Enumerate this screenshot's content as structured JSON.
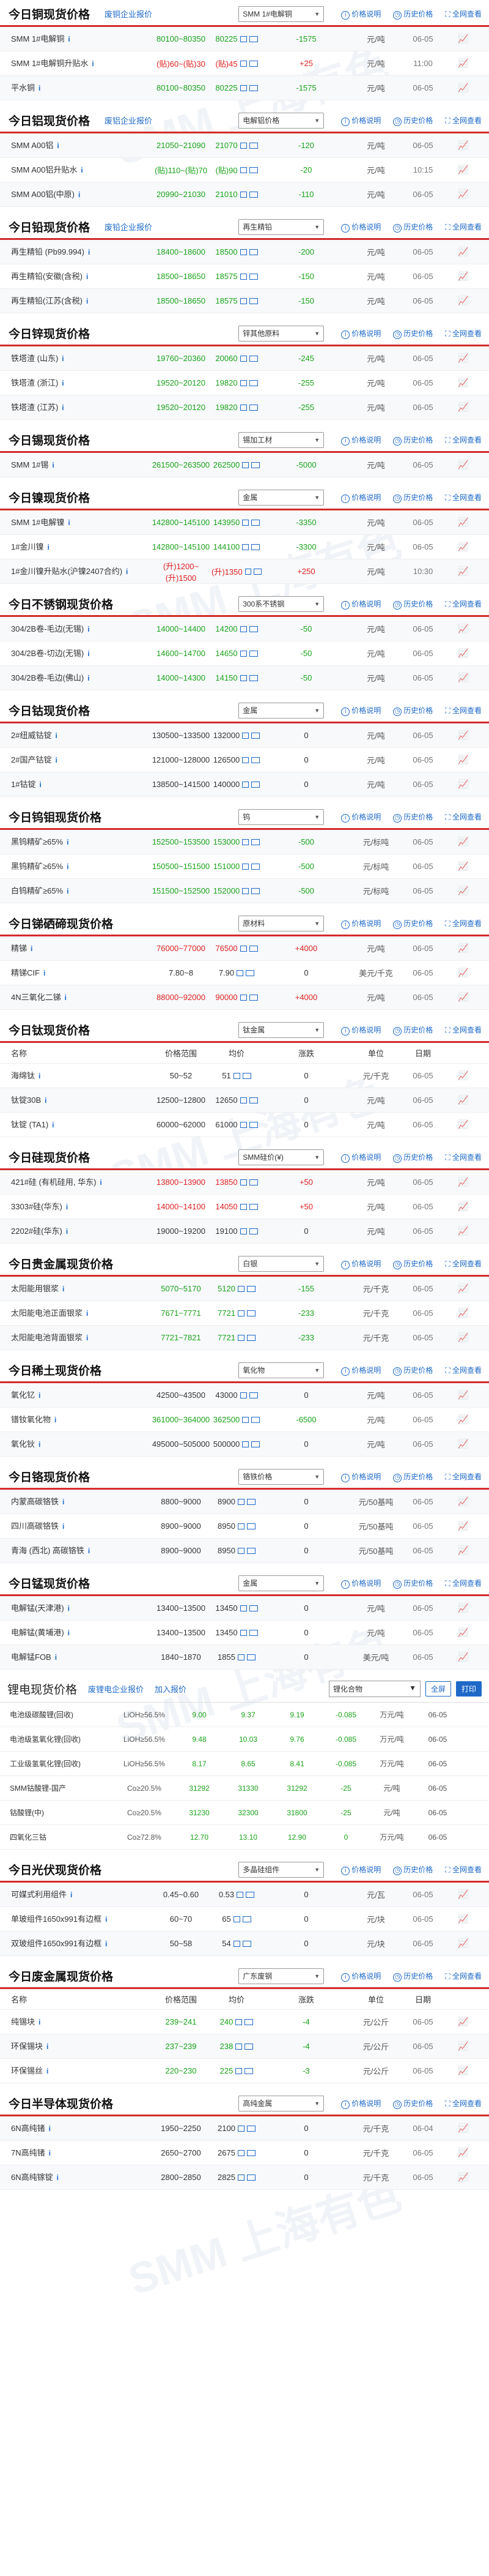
{
  "common": {
    "trend_icon": "trend-chart-icon",
    "detail_icon": "i",
    "price_link": "价格说明",
    "hist_link": "历史价格",
    "full_link": "全网查看"
  },
  "copper": {
    "title": "今日铜现货价格",
    "entry": "废铜企业报价",
    "select": "SMM 1#电解铜",
    "rows": [
      {
        "name": "SMM 1#电解铜",
        "range": "80100~80350",
        "avg": "80225",
        "chg": "-1575",
        "unit": "元/吨",
        "date": "06-05"
      },
      {
        "name": "SMM 1#电解铜升贴水",
        "range": "(贴)60~(贴)30",
        "avg": "(贴)45",
        "chg": "+25",
        "unit": "元/吨",
        "date": "11:00"
      },
      {
        "name": "平水铜",
        "range": "80100~80350",
        "avg": "80225",
        "chg": "-1575",
        "unit": "元/吨",
        "date": "06-05"
      }
    ]
  },
  "aluminum": {
    "title": "今日铝现货价格",
    "entry": "废铝企业报价",
    "select": "电解铝价格",
    "rows": [
      {
        "name": "SMM A00铝",
        "range": "21050~21090",
        "avg": "21070",
        "chg": "-120",
        "unit": "元/吨",
        "date": "06-05"
      },
      {
        "name": "SMM A00铝升贴水",
        "range": "(贴)110~(贴)70",
        "avg": "(贴)90",
        "chg": "-20",
        "unit": "元/吨",
        "date": "10:15"
      },
      {
        "name": "SMM A00铝(中原)",
        "range": "20990~21030",
        "avg": "21010",
        "chg": "-110",
        "unit": "元/吨",
        "date": "06-05"
      }
    ]
  },
  "lead": {
    "title": "今日铅现货价格",
    "entry": "废铅企业报价",
    "select": "再生精铅",
    "rows": [
      {
        "name": "再生精铅 (Pb99.994)",
        "range": "18400~18600",
        "avg": "18500",
        "chg": "-200",
        "unit": "元/吨",
        "date": "06-05"
      },
      {
        "name": "再生精铅(安徽(含税)",
        "range": "18500~18650",
        "avg": "18575",
        "chg": "-150",
        "unit": "元/吨",
        "date": "06-05"
      },
      {
        "name": "再生精铅(江苏(含税)",
        "range": "18500~18650",
        "avg": "18575",
        "chg": "-150",
        "unit": "元/吨",
        "date": "06-05"
      }
    ]
  },
  "zinc": {
    "title": "今日锌现货价格",
    "select": "锌其他原料",
    "rows": [
      {
        "name": "铁塔渣 (山东)",
        "range": "19760~20360",
        "avg": "20060",
        "chg": "-245",
        "unit": "元/吨",
        "date": "06-05"
      },
      {
        "name": "铁塔渣 (浙江)",
        "range": "19520~20120",
        "avg": "19820",
        "chg": "-255",
        "unit": "元/吨",
        "date": "06-05"
      },
      {
        "name": "铁塔渣 (江苏)",
        "range": "19520~20120",
        "avg": "19820",
        "chg": "-255",
        "unit": "元/吨",
        "date": "06-05"
      }
    ]
  },
  "tin": {
    "title": "今日锡现货价格",
    "select": "锡加工材",
    "rows": [
      {
        "name": "SMM 1#锡",
        "range": "261500~263500",
        "avg": "262500",
        "chg": "-5000",
        "unit": "元/吨",
        "date": "06-05"
      }
    ]
  },
  "nickel": {
    "title": "今日镍现货价格",
    "select": "金属",
    "rows": [
      {
        "name": "SMM 1#电解镍",
        "range": "142800~145100",
        "avg": "143950",
        "chg": "-3350",
        "unit": "元/吨",
        "date": "06-05"
      },
      {
        "name": "1#金川镍",
        "range": "142800~145100",
        "avg": "144100",
        "chg": "-3300",
        "unit": "元/吨",
        "date": "06-05"
      },
      {
        "name": "1#金川镍升贴水(沪镍2407合约)",
        "range": "(升)1200~(升)1500",
        "avg": "(升)1350",
        "chg": "+250",
        "unit": "元/吨",
        "date": "10:30"
      }
    ]
  },
  "stainless": {
    "title": "今日不锈钢现货价格",
    "select": "300系不锈钢",
    "rows": [
      {
        "name": "304/2B卷-毛边(无锡)",
        "range": "14000~14400",
        "avg": "14200",
        "chg": "-50",
        "unit": "元/吨",
        "date": "06-05"
      },
      {
        "name": "304/2B卷-切边(无锡)",
        "range": "14600~14700",
        "avg": "14650",
        "chg": "-50",
        "unit": "元/吨",
        "date": "06-05"
      },
      {
        "name": "304/2B卷-毛边(佛山)",
        "range": "14000~14300",
        "avg": "14150",
        "chg": "-50",
        "unit": "元/吨",
        "date": "06-05"
      }
    ]
  },
  "cobalt": {
    "title": "今日钴现货价格",
    "select": "金属",
    "rows": [
      {
        "name": "2#纽威钴锭",
        "range": "130500~133500",
        "avg": "132000",
        "chg": "0",
        "unit": "元/吨",
        "date": "06-05"
      },
      {
        "name": "2#国产钴锭",
        "range": "121000~128000",
        "avg": "126500",
        "chg": "0",
        "unit": "元/吨",
        "date": "06-05"
      },
      {
        "name": "1#钴锭",
        "range": "138500~141500",
        "avg": "140000",
        "chg": "0",
        "unit": "元/吨",
        "date": "06-05"
      }
    ]
  },
  "tungsten": {
    "title": "今日钨钼现货价格",
    "select": "钨",
    "rows": [
      {
        "name": "黑钨精矿≥65%",
        "range": "152500~153500",
        "avg": "153000",
        "chg": "-500",
        "unit": "元/标吨",
        "date": "06-05"
      },
      {
        "name": "黑钨精矿≥65%",
        "range": "150500~151500",
        "avg": "151000",
        "chg": "-500",
        "unit": "元/标吨",
        "date": "06-05"
      },
      {
        "name": "白钨精矿≥65%",
        "range": "151500~152500",
        "avg": "152000",
        "chg": "-500",
        "unit": "元/标吨",
        "date": "06-05"
      }
    ]
  },
  "antimony": {
    "title": "今日锑硒碲现货价格",
    "select": "原材料",
    "rows": [
      {
        "name": "精锑",
        "range": "76000~77000",
        "avg": "76500",
        "chg": "+4000",
        "unit": "元/吨",
        "date": "06-05"
      },
      {
        "name": "精锑CIF",
        "range": "7.80~8",
        "avg": "7.90",
        "chg": "0",
        "unit": "美元/千克",
        "date": "06-05"
      },
      {
        "name": "4N三氧化二锑",
        "range": "88000~92000",
        "avg": "90000",
        "chg": "+4000",
        "unit": "元/吨",
        "date": "06-05"
      }
    ]
  },
  "titanium": {
    "title": "今日钛现货价格",
    "select": "钛金属",
    "cols": [
      "名称",
      "价格范围",
      "均价",
      "涨跌",
      "单位",
      "日期"
    ],
    "rows": [
      {
        "name": "海绵钛",
        "range": "50~52",
        "avg": "51",
        "chg": "0",
        "unit": "元/千克",
        "date": "06-05"
      },
      {
        "name": "钛锭30B",
        "range": "12500~12800",
        "avg": "12650",
        "chg": "0",
        "unit": "元/吨",
        "date": "06-05"
      },
      {
        "name": "钛锭 (TA1)",
        "range": "60000~62000",
        "avg": "61000",
        "chg": "0",
        "unit": "元/吨",
        "date": "06-05"
      }
    ]
  },
  "silicon": {
    "title": "今日硅现货价格",
    "select": "SMM硅价(¥)",
    "rows": [
      {
        "name": "421#硅 (有机硅用, 华东)",
        "range": "13800~13900",
        "avg": "13850",
        "chg": "+50",
        "unit": "元/吨",
        "date": "06-05"
      },
      {
        "name": "3303#硅(华东)",
        "range": "14000~14100",
        "avg": "14050",
        "chg": "+50",
        "unit": "元/吨",
        "date": "06-05"
      },
      {
        "name": "2202#硅(华东)",
        "range": "19000~19200",
        "avg": "19100",
        "chg": "0",
        "unit": "元/吨",
        "date": "06-05"
      }
    ]
  },
  "precious": {
    "title": "今日贵金属现货价格",
    "select": "白银",
    "rows": [
      {
        "name": "太阳能用银浆",
        "range": "5070~5170",
        "avg": "5120",
        "chg": "-155",
        "unit": "元/千克",
        "date": "06-05"
      },
      {
        "name": "太阳能电池正面银浆",
        "range": "7671~7771",
        "avg": "7721",
        "chg": "-233",
        "unit": "元/千克",
        "date": "06-05"
      },
      {
        "name": "太阳能电池背面银浆",
        "range": "7721~7821",
        "avg": "7721",
        "chg": "-233",
        "unit": "元/千克",
        "date": "06-05"
      }
    ]
  },
  "rare": {
    "title": "今日稀土现货价格",
    "select": "氧化物",
    "rows": [
      {
        "name": "氧化钇",
        "range": "42500~43500",
        "avg": "43000",
        "chg": "0",
        "unit": "元/吨",
        "date": "06-05"
      },
      {
        "name": "镨钕氧化物",
        "range": "361000~364000",
        "avg": "362500",
        "chg": "-6500",
        "unit": "元/吨",
        "date": "06-05"
      },
      {
        "name": "氧化钬",
        "range": "495000~505000",
        "avg": "500000",
        "chg": "0",
        "unit": "元/吨",
        "date": "06-05"
      }
    ]
  },
  "chrome": {
    "title": "今日铬现货价格",
    "select": "铬铁价格",
    "rows": [
      {
        "name": "内蒙高碳铬铁",
        "range": "8800~9000",
        "avg": "8900",
        "chg": "0",
        "unit": "元/50基吨",
        "date": "06-05"
      },
      {
        "name": "四川高碳铬铁",
        "range": "8900~9000",
        "avg": "8950",
        "chg": "0",
        "unit": "元/50基吨",
        "date": "06-05"
      },
      {
        "name": "青海 (西北) 高碳铬铁",
        "range": "8900~9000",
        "avg": "8950",
        "chg": "0",
        "unit": "元/50基吨",
        "date": "06-05"
      }
    ]
  },
  "manganese": {
    "title": "今日锰现货价格",
    "select": "金属",
    "rows": [
      {
        "name": "电解锰(天津港)",
        "range": "13400~13500",
        "avg": "13450",
        "chg": "0",
        "unit": "元/吨",
        "date": "06-05"
      },
      {
        "name": "电解锰(黄埔港)",
        "range": "13400~13500",
        "avg": "13450",
        "chg": "0",
        "unit": "元/吨",
        "date": "06-05"
      },
      {
        "name": "电解锰FOB",
        "range": "1840~1870",
        "avg": "1855",
        "chg": "0",
        "unit": "美元/吨",
        "date": "06-05"
      }
    ]
  },
  "lithium": {
    "title": "锂电现货价格",
    "links": [
      "废锂电企业报价",
      "加入报价"
    ],
    "select": "锂化合物",
    "full": "全屏",
    "print": "打印",
    "rows": [
      {
        "name": "电池级碳酸锂(回收)",
        "gr": "LiOH≥56.5%",
        "a": "9.00",
        "b": "9.37",
        "c": "9.19",
        "d": "-0.085",
        "e": "万元/吨",
        "f": "06-05"
      },
      {
        "name": "电池级氢氧化锂(回收)",
        "gr": "LiOH≥56.5%",
        "a": "9.48",
        "b": "10.03",
        "c": "9.76",
        "d": "-0.085",
        "e": "万元/吨",
        "f": "06-05"
      },
      {
        "name": "工业级氢氧化锂(回收)",
        "gr": "LiOH≥56.5%",
        "a": "8.17",
        "b": "8.65",
        "c": "8.41",
        "d": "-0.085",
        "e": "万元/吨",
        "f": "06-05"
      },
      {
        "name": "SMM钴酸锂-国产",
        "gr": "Co≥20.5%",
        "a": "31292",
        "b": "31330",
        "c": "31292",
        "d": "-25",
        "e": "元/吨",
        "f": "06-05"
      },
      {
        "name": "钴酸锂(中)",
        "gr": "Co≥20.5%",
        "a": "31230",
        "b": "32300",
        "c": "31800",
        "d": "-25",
        "e": "元/吨",
        "f": "06-05"
      },
      {
        "name": "四氧化三钴",
        "gr": "Co≥72.8%",
        "a": "12.70",
        "b": "13.10",
        "c": "12.90",
        "d": "0",
        "e": "万元/吨",
        "f": "06-05"
      }
    ]
  },
  "solar": {
    "title": "今日光伏现货价格",
    "select": "多晶硅组件",
    "rows": [
      {
        "name": "可媒式利用组件",
        "range": "0.45~0.60",
        "avg": "0.53",
        "chg": "0",
        "unit": "元/瓦",
        "date": "06-05"
      },
      {
        "name": "单玻组件1650x991有边框",
        "range": "60~70",
        "avg": "65",
        "chg": "0",
        "unit": "元/块",
        "date": "06-05"
      },
      {
        "name": "双玻组件1650x991有边框",
        "range": "50~58",
        "avg": "54",
        "chg": "0",
        "unit": "元/块",
        "date": "06-05"
      }
    ]
  },
  "scrap": {
    "title": "今日废金属现货价格",
    "links": [
      "企业报价",
      "加入报价"
    ],
    "select": "广东废钢",
    "cols": [
      "名称",
      "价格范围",
      "均价",
      "涨跌",
      "单位",
      "日期"
    ],
    "rows": [
      {
        "name": "纯锡块",
        "range": "239~241",
        "avg": "240",
        "chg": "-4",
        "unit": "元/公斤",
        "date": "06-05"
      },
      {
        "name": "环保锡块",
        "range": "237~239",
        "avg": "238",
        "chg": "-4",
        "unit": "元/公斤",
        "date": "06-05"
      },
      {
        "name": "环保锡丝",
        "range": "220~230",
        "avg": "225",
        "chg": "-3",
        "unit": "元/公斤",
        "date": "06-05"
      }
    ]
  },
  "semi": {
    "title": "今日半导体现货价格",
    "select": "高纯金属",
    "rows": [
      {
        "name": "6N高纯锗",
        "range": "1950~2250",
        "avg": "2100",
        "chg": "0",
        "unit": "元/千克",
        "date": "06-04"
      },
      {
        "name": "7N高纯锗",
        "range": "2650~2700",
        "avg": "2675",
        "chg": "0",
        "unit": "元/千克",
        "date": "06-05"
      },
      {
        "name": "6N高纯镓锭",
        "range": "2800~2850",
        "avg": "2825",
        "chg": "0",
        "unit": "元/千克",
        "date": "06-05"
      }
    ]
  }
}
